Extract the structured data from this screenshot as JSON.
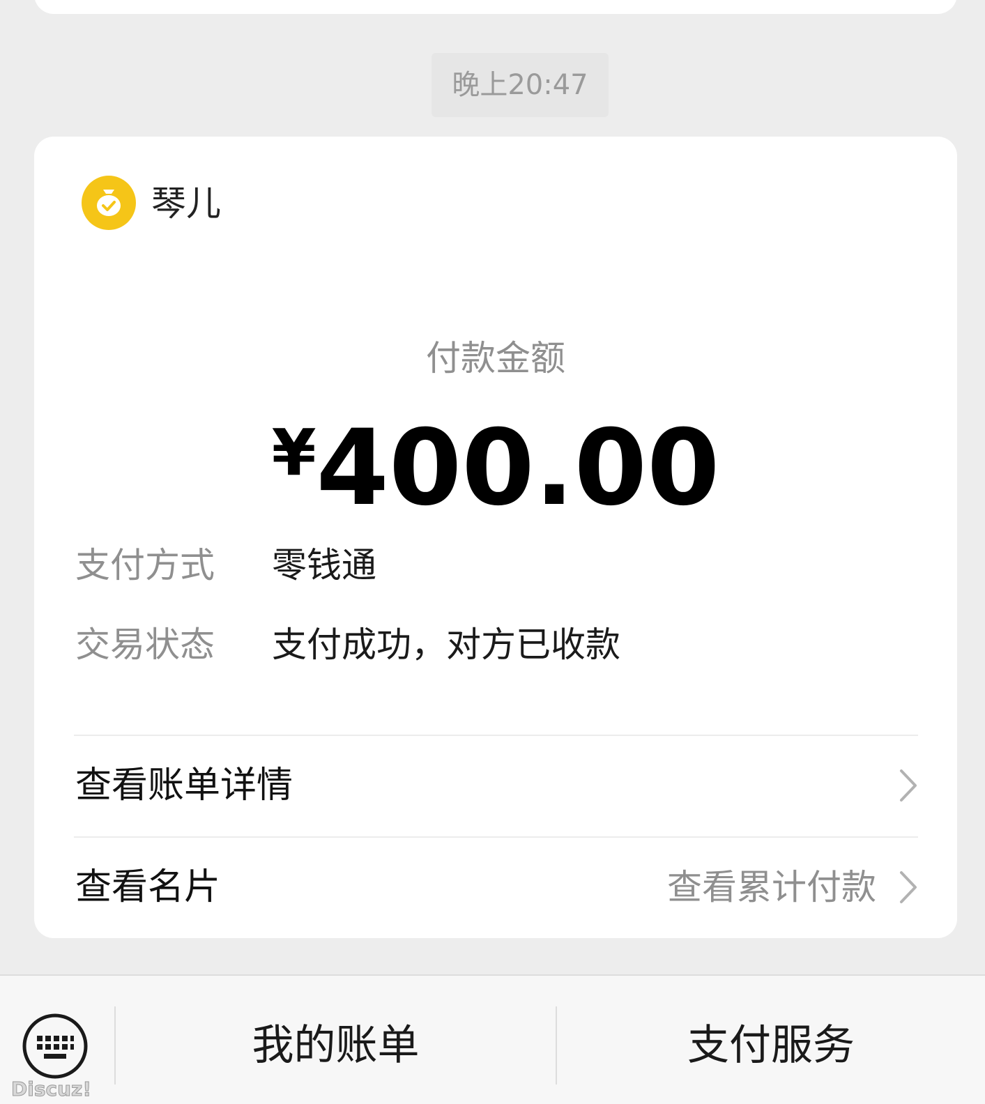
{
  "timestamp": "晚上20:47",
  "merchant": {
    "name": "琴儿",
    "icon": "money-bag-check-icon",
    "icon_color": "#f5c518"
  },
  "payment": {
    "amount_label": "付款金额",
    "currency_symbol": "¥",
    "amount": "400.00",
    "details": [
      {
        "key": "支付方式",
        "value": "零钱通"
      },
      {
        "key": "交易状态",
        "value": "支付成功，对方已收款"
      }
    ]
  },
  "links": {
    "bill_details": "查看账单详情",
    "business_card": "查看名片",
    "cumulative_payments": "查看累计付款"
  },
  "bottom_bar": {
    "keyboard_icon": "keyboard-icon",
    "my_bills": "我的账单",
    "pay_service": "支付服务"
  },
  "watermark": "Discuz!"
}
